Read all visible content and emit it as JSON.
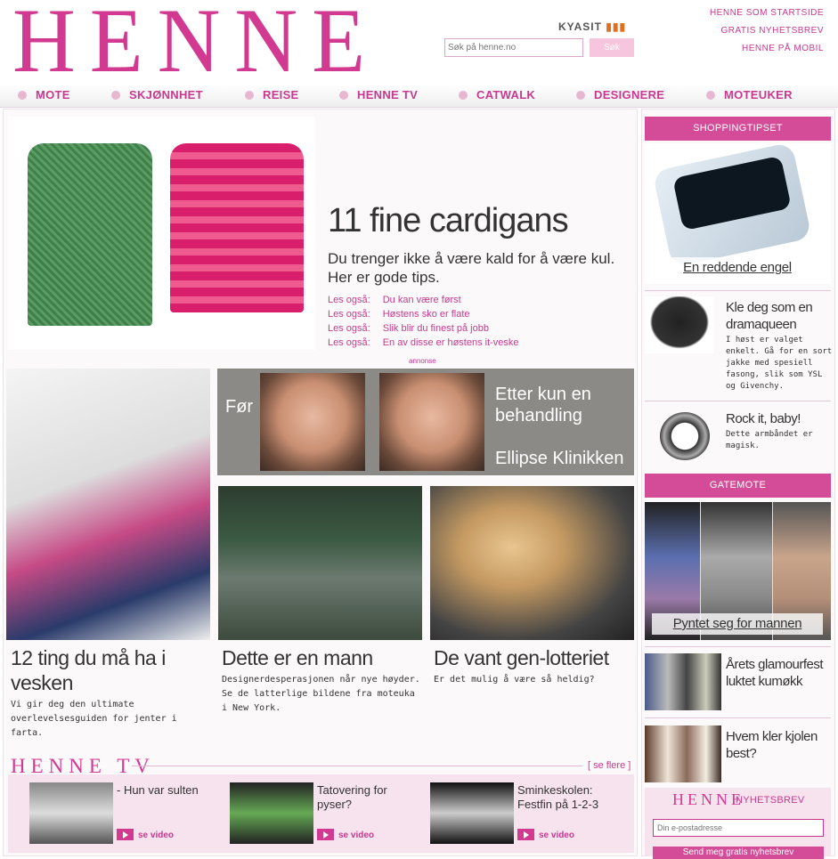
{
  "header": {
    "logo": "HENNE",
    "partner": "KYASIT",
    "links": [
      "HENNE SOM STARTSIDE",
      "GRATIS NYHETSBREV",
      "HENNE PÅ MOBIL"
    ],
    "search_placeholder": "Søk på henne.no",
    "search_button": "Søk"
  },
  "nav": [
    "MOTE",
    "SKJØNNHET",
    "REISE",
    "HENNE TV",
    "CATWALK",
    "DESIGNERE",
    "MOTEUKER"
  ],
  "hero": {
    "title": "11 fine cardigans",
    "subtitle": "Du trenger ikke å være kald for å være kul. Her er gode tips.",
    "read_also_label": "Les også:",
    "read_also": [
      "Du kan være først",
      "Høstens sko er flate",
      "Slik blir du finest på jobb",
      "En av disse er høstens it-veske"
    ]
  },
  "ad": {
    "label": "annonse",
    "before": "Før",
    "after": "Etter kun en behandling",
    "clinic": "Ellipse Klinikken"
  },
  "articles": [
    {
      "title": "12 ting du må ha i vesken",
      "desc": "Vi gir deg den ultimate overlevelsesguiden for jenter i farta."
    },
    {
      "title": "Dette er en mann",
      "desc": "Designerdesperasjonen når nye høyder. Se de latterlige bildene fra moteuka i New York."
    },
    {
      "title": "De vant gen-lotteriet",
      "desc": "Er det mulig å være så heldig?"
    }
  ],
  "henne_tv": {
    "logo": "HENNE TV",
    "more": "[ se flere ]",
    "watch_label": "se video",
    "items": [
      "- Hun var sulten",
      "Tatovering for pyser?",
      "Sminkeskolen: Festfin på 1-2-3"
    ]
  },
  "sidebar": {
    "shopping_head": "SHOPPINGTIPSET",
    "shopping_caption": "En reddende engel",
    "items": [
      {
        "title": "Kle deg som en dramaqueen",
        "desc": "I høst er valget enkelt. Gå for en sort jakke med spesiell fasong, slik som YSL og Givenchy."
      },
      {
        "title": "Rock it, baby!",
        "desc": "Dette armbåndet er magisk."
      }
    ],
    "gatemote_head": "GATEMOTE",
    "gatemote_caption": "Pyntet seg for mannen",
    "items2": [
      {
        "title": "Årets glamourfest luktet kumøkk"
      },
      {
        "title": "Hvem kler kjolen best?"
      }
    ],
    "newsletter": {
      "logo": "HENNE",
      "label": "NYHETSBREV",
      "placeholder": "Din e-postadresse",
      "button": "Send meg gratis nyhetsbrev"
    }
  }
}
